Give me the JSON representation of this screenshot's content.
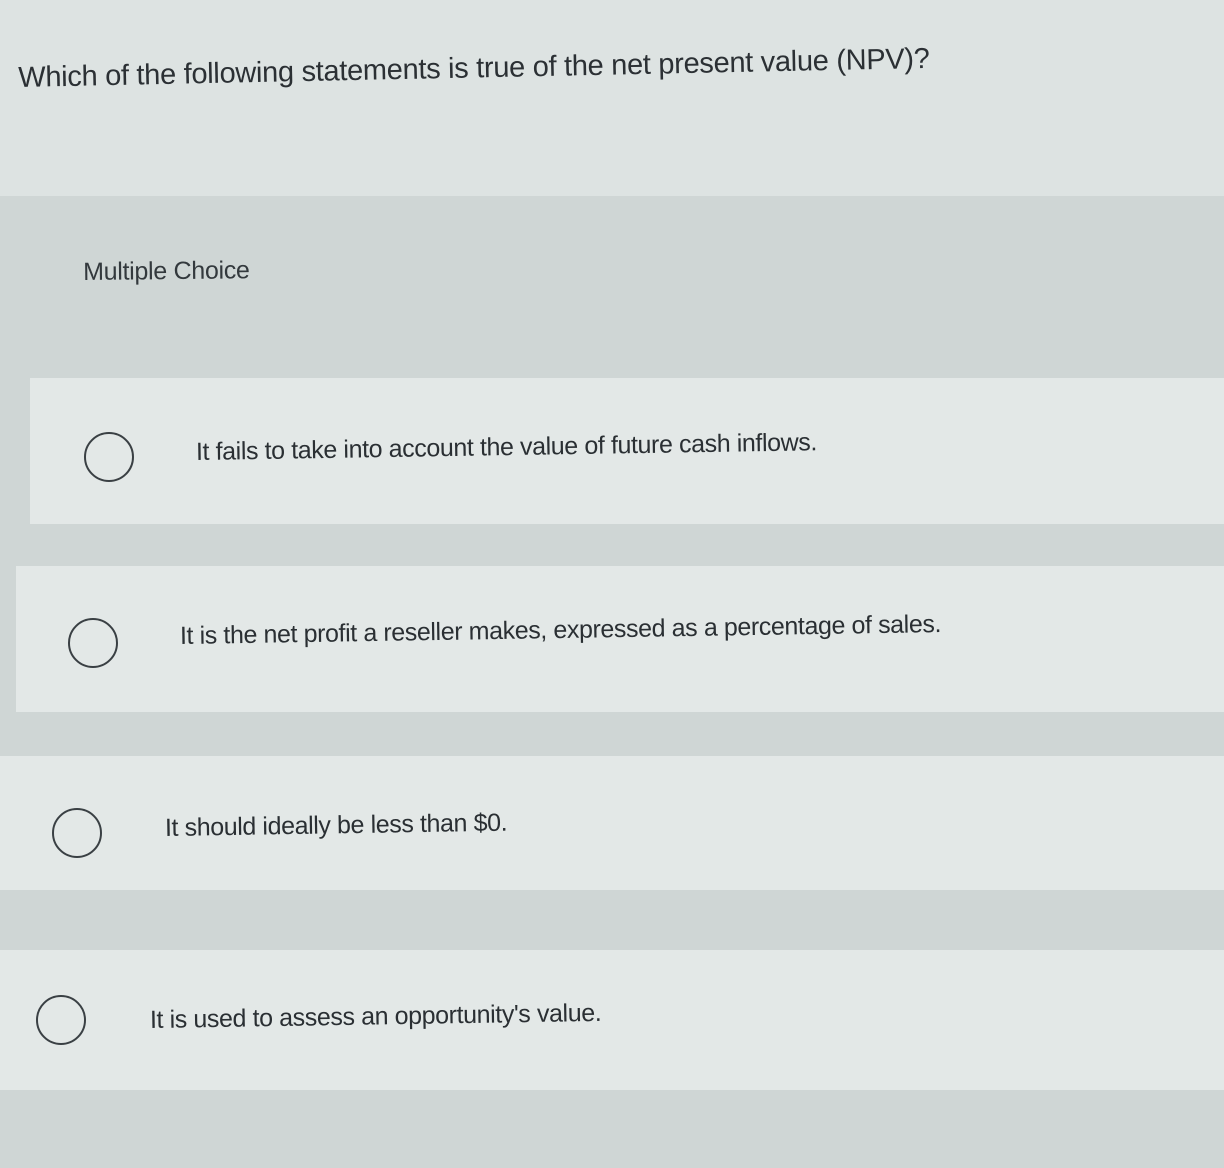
{
  "question": {
    "text": "Which of the following statements is true of the net present value (NPV)?"
  },
  "multiple_choice": {
    "label": "Multiple Choice",
    "options": [
      {
        "text": "It fails to take into account the value of future cash inflows.",
        "selected": false
      },
      {
        "text": "It is the net profit a reseller makes, expressed as a percentage of sales.",
        "selected": false
      },
      {
        "text": "It should ideally be less than $0.",
        "selected": false
      },
      {
        "text": "It is used to assess an opportunity's value.",
        "selected": false
      }
    ]
  },
  "colors": {
    "page_background": "#dde3e2",
    "panel_background": "#cfd6d5",
    "option_background": "#e3e8e7",
    "text": "#2a2f33"
  }
}
